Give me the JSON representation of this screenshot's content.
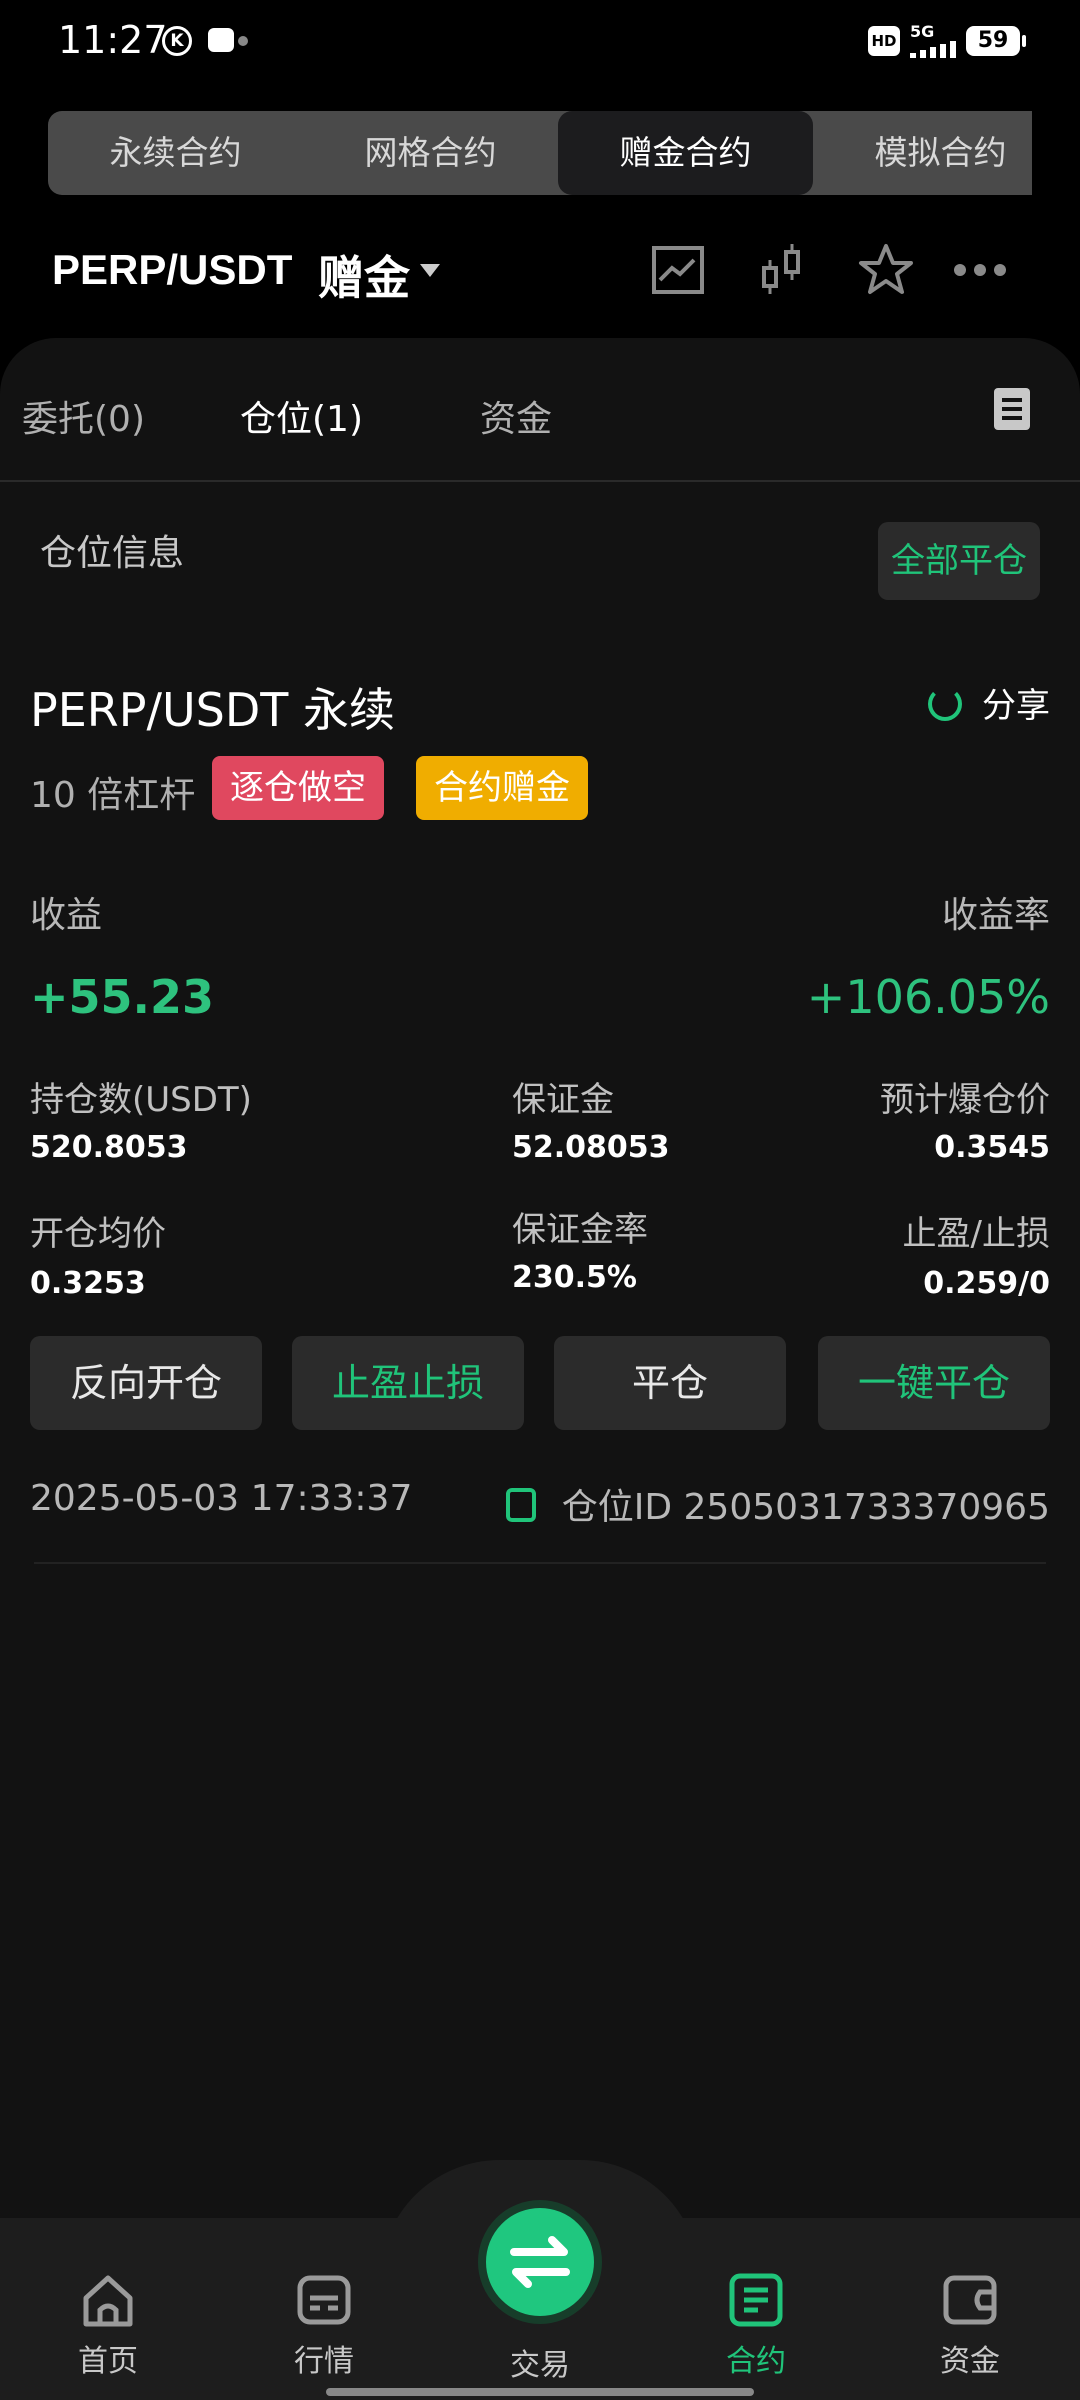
{
  "status_bar": {
    "time": "11:27",
    "k_icon": "K",
    "hd": "HD",
    "net": "5G",
    "battery": "59"
  },
  "top_tabs": [
    {
      "label": "永续合约",
      "active": false
    },
    {
      "label": "网格合约",
      "active": false
    },
    {
      "label": "赠金合约",
      "active": true
    },
    {
      "label": "模拟合约",
      "active": false
    }
  ],
  "header": {
    "pair": "PERP/USDT",
    "mode": "赠金",
    "icons": [
      "line-chart-icon",
      "candlestick-icon",
      "star-icon",
      "more-icon"
    ]
  },
  "sub_tabs": {
    "orders": "委托(0)",
    "positions": "仓位(1)",
    "funds": "资金"
  },
  "section": {
    "title": "仓位信息",
    "close_all": "全部平仓"
  },
  "position": {
    "title": "PERP/USDT 永续",
    "share": "分享",
    "leverage": "10 倍杠杆",
    "badge_side": "逐仓做空",
    "badge_bonus": "合约赠金",
    "pnl_label": "收益",
    "pnl_value": "+55.23",
    "roe_label": "收益率",
    "roe_value": "+106.05%",
    "size_label": "持仓数(USDT)",
    "size_value": "520.8053",
    "margin_label": "保证金",
    "margin_value": "52.08053",
    "liq_label": "预计爆仓价",
    "liq_value": "0.3545",
    "entry_label": "开仓均价",
    "entry_value": "0.3253",
    "margin_ratio_label": "保证金率",
    "margin_ratio_value": "230.5%",
    "tpsl_label": "止盈/止损",
    "tpsl_value": "0.259/0",
    "actions": {
      "reverse": "反向开仓",
      "tpsl": "止盈止损",
      "close": "平仓",
      "close_one": "一键平仓"
    },
    "timestamp": "2025-05-03 17:33:37",
    "position_id": "仓位ID 2505031733370965"
  },
  "bottom_nav": {
    "home": "首页",
    "market": "行情",
    "trade": "交易",
    "contract": "合约",
    "assets": "资金"
  },
  "colors": {
    "accent_green": "#20c47a",
    "short_red": "#e0485f",
    "bonus_yellow": "#f0ad00"
  }
}
